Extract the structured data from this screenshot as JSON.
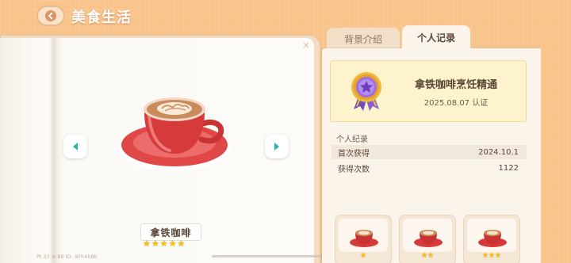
{
  "header": {
    "title": "美食生活",
    "back_icon": "back-arrow-icon"
  },
  "tabs": [
    {
      "label": "背景介绍",
      "active": false
    },
    {
      "label": "个人记录",
      "active": true
    }
  ],
  "item": {
    "name": "拿铁咖啡",
    "stars": [
      "★",
      "★",
      "★",
      "★",
      "★"
    ]
  },
  "certificate": {
    "title": "拿铁咖啡烹饪精通",
    "date": "2025.08.07 认证",
    "icon": "medal-star-icon"
  },
  "record": {
    "section_label": "个人纪录",
    "rows": [
      {
        "label": "首次获得",
        "value": "2024.10.1"
      },
      {
        "label": "获得次数",
        "value": "1122"
      }
    ]
  },
  "collection": [
    {
      "stars": "★"
    },
    {
      "stars": "★★"
    },
    {
      "stars": "★★★"
    }
  ],
  "footer": {
    "text": "Pt 33   N:88   ID: 9Fh4h8b"
  },
  "colors": {
    "background": "#f8c48c",
    "accent_teal": "#2cb3b0",
    "star": "#f5c21c",
    "cup_red": "#d63a3a",
    "medal_purple": "#8a5fd0"
  }
}
